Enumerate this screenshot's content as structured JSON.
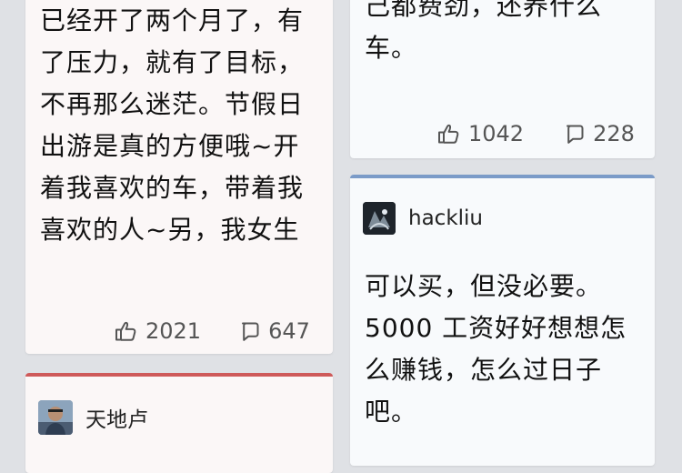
{
  "colors": {
    "page_bg": "#dfe1e5",
    "card_bg_left": "#fbf7f7",
    "card_bg_right": "#f8fafc",
    "accent_red": "#ce5a5a",
    "accent_blue": "#7b9bc8"
  },
  "left_column": {
    "top_post": {
      "text_lines": [
        "已经开了两个月了，有",
        "了压力，就有了目标，",
        "不再那么迷茫。节假日",
        "出游是真的方便哦~开",
        "着我喜欢的车，带着我",
        "喜欢的人~另，我女生"
      ],
      "likes_icon": "thumbs-up-icon",
      "likes": "2021",
      "comments_icon": "comment-bubble-icon",
      "comments": "647"
    },
    "second_post": {
      "author_name": "天地卢",
      "avatar": "avatar-photo"
    }
  },
  "right_column": {
    "top_post": {
      "text_lines": [
        "己都费劲，还养什么",
        "车。"
      ],
      "likes_icon": "thumbs-up-icon",
      "likes": "1042",
      "comments_icon": "comment-bubble-icon",
      "comments": "228"
    },
    "second_post": {
      "author_name": "hackliu",
      "avatar": "avatar-photo",
      "text_lines": [
        "可以买，但没必要。",
        "5000 工资好好想想怎",
        "么赚钱，怎么过日子",
        "吧。"
      ]
    }
  }
}
